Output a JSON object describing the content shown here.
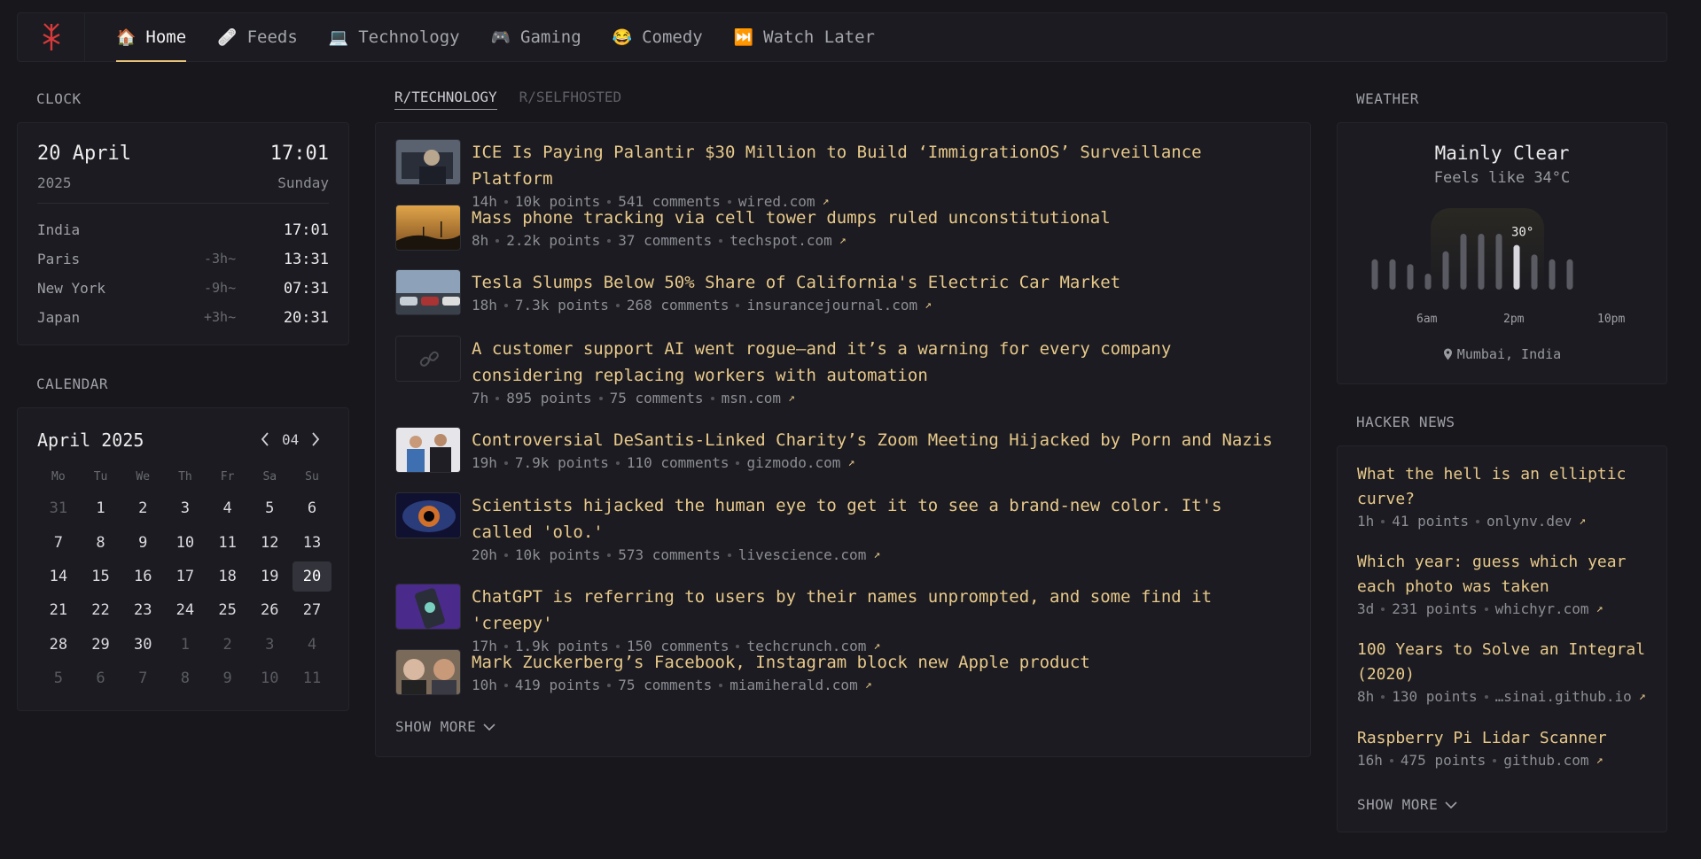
{
  "nav": {
    "tabs": [
      {
        "emoji": "🏠",
        "label": "Home"
      },
      {
        "emoji": "🩹",
        "label": "Feeds"
      },
      {
        "emoji": "💻",
        "label": "Technology"
      },
      {
        "emoji": "🎮",
        "label": "Gaming"
      },
      {
        "emoji": "😂",
        "label": "Comedy"
      },
      {
        "emoji": "⏭️",
        "label": "Watch Later"
      }
    ],
    "active": "Home",
    "accent": "#e6c27a"
  },
  "clock": {
    "title": "CLOCK",
    "date": "20 April",
    "year": "2025",
    "time": "17:01",
    "day": "Sunday",
    "zones": [
      {
        "city": "India",
        "offset": "",
        "time": "17:01"
      },
      {
        "city": "Paris",
        "offset": "-3h~",
        "time": "13:31"
      },
      {
        "city": "New York",
        "offset": "-9h~",
        "time": "07:31"
      },
      {
        "city": "Japan",
        "offset": "+3h~",
        "time": "20:31"
      }
    ]
  },
  "calendar": {
    "title": "CALENDAR",
    "month_label": "April 2025",
    "month_number": "04",
    "weekdays": [
      "Mo",
      "Tu",
      "We",
      "Th",
      "Fr",
      "Sa",
      "Su"
    ],
    "days": [
      {
        "d": "31",
        "m": true
      },
      {
        "d": "1"
      },
      {
        "d": "2"
      },
      {
        "d": "3"
      },
      {
        "d": "4"
      },
      {
        "d": "5"
      },
      {
        "d": "6"
      },
      {
        "d": "7"
      },
      {
        "d": "8"
      },
      {
        "d": "9"
      },
      {
        "d": "10"
      },
      {
        "d": "11"
      },
      {
        "d": "12"
      },
      {
        "d": "13"
      },
      {
        "d": "14"
      },
      {
        "d": "15"
      },
      {
        "d": "16"
      },
      {
        "d": "17"
      },
      {
        "d": "18"
      },
      {
        "d": "19"
      },
      {
        "d": "20",
        "today": true
      },
      {
        "d": "21"
      },
      {
        "d": "22"
      },
      {
        "d": "23"
      },
      {
        "d": "24"
      },
      {
        "d": "25"
      },
      {
        "d": "26"
      },
      {
        "d": "27"
      },
      {
        "d": "28"
      },
      {
        "d": "29"
      },
      {
        "d": "30"
      },
      {
        "d": "1",
        "m": true
      },
      {
        "d": "2",
        "m": true
      },
      {
        "d": "3",
        "m": true
      },
      {
        "d": "4",
        "m": true
      },
      {
        "d": "5",
        "m": true
      },
      {
        "d": "6",
        "m": true
      },
      {
        "d": "7",
        "m": true
      },
      {
        "d": "8",
        "m": true
      },
      {
        "d": "9",
        "m": true
      },
      {
        "d": "10",
        "m": true
      },
      {
        "d": "11",
        "m": true
      }
    ]
  },
  "feed": {
    "tabs": [
      "R/TECHNOLOGY",
      "R/SELFHOSTED"
    ],
    "active_tab": "R/TECHNOLOGY",
    "stories": [
      {
        "title": "ICE Is Paying Palantir $30 Million to Build ‘ImmigrationOS’ Surveillance Platform",
        "age": "14h",
        "points": "10k points",
        "comments": "541 comments",
        "domain": "wired.com",
        "thumb": "tech-portrait"
      },
      {
        "title": "Mass phone tracking via cell tower dumps ruled unconstitutional",
        "age": "8h",
        "points": "2.2k points",
        "comments": "37 comments",
        "domain": "techspot.com",
        "thumb": "sunset-towers"
      },
      {
        "title": "Tesla Slumps Below 50% Share of California's Electric Car Market",
        "age": "18h",
        "points": "7.3k points",
        "comments": "268 comments",
        "domain": "insurancejournal.com",
        "thumb": "car-lot"
      },
      {
        "title": "A customer support AI went rogue—and it’s a warning for every company considering replacing workers with automation",
        "age": "7h",
        "points": "895 points",
        "comments": "75 comments",
        "domain": "msn.com",
        "thumb": "link-icon"
      },
      {
        "title": "Controversial DeSantis-Linked Charity’s Zoom Meeting Hijacked by Porn and Nazis",
        "age": "19h",
        "points": "7.9k points",
        "comments": "110 comments",
        "domain": "gizmodo.com",
        "thumb": "two-people"
      },
      {
        "title": "Scientists hijacked the human eye to get it to see a brand-new color. It's called 'olo.'",
        "age": "20h",
        "points": "10k points",
        "comments": "573 comments",
        "domain": "livescience.com",
        "thumb": "eye"
      },
      {
        "title": "ChatGPT is referring to users by their names unprompted, and some find it 'creepy'",
        "age": "17h",
        "points": "1.9k points",
        "comments": "150 comments",
        "domain": "techcrunch.com",
        "thumb": "phone"
      },
      {
        "title": "Mark Zuckerberg’s Facebook, Instagram block new Apple product",
        "age": "10h",
        "points": "419 points",
        "comments": "75 comments",
        "domain": "miamiherald.com",
        "thumb": "two-faces"
      }
    ],
    "show_more": "SHOW MORE"
  },
  "weather": {
    "title": "WEATHER",
    "condition": "Mainly Clear",
    "feels_like": "Feels like 34°C",
    "current_temp": "30°",
    "hour_labels": [
      "6am",
      "2pm",
      "10pm"
    ],
    "bar_levels": [
      0.38,
      0.38,
      0.32,
      0.2,
      0.48,
      0.7,
      0.7,
      0.7,
      0.56,
      0.44,
      0.38,
      0.38
    ],
    "current_index": 8,
    "location": "Mumbai, India"
  },
  "hn": {
    "title": "HACKER NEWS",
    "items": [
      {
        "title": "What the hell is an elliptic curve?",
        "age": "1h",
        "points": "41 points",
        "domain": "onlynv.dev"
      },
      {
        "title": "Which year: guess which year each photo was taken",
        "age": "3d",
        "points": "231 points",
        "domain": "whichyr.com"
      },
      {
        "title": "100 Years to Solve an Integral (2020)",
        "age": "8h",
        "points": "130 points",
        "domain": "…sinai.github.io"
      },
      {
        "title": "Raspberry Pi Lidar Scanner",
        "age": "16h",
        "points": "475 points",
        "domain": "github.com"
      }
    ],
    "show_more": "SHOW MORE"
  }
}
